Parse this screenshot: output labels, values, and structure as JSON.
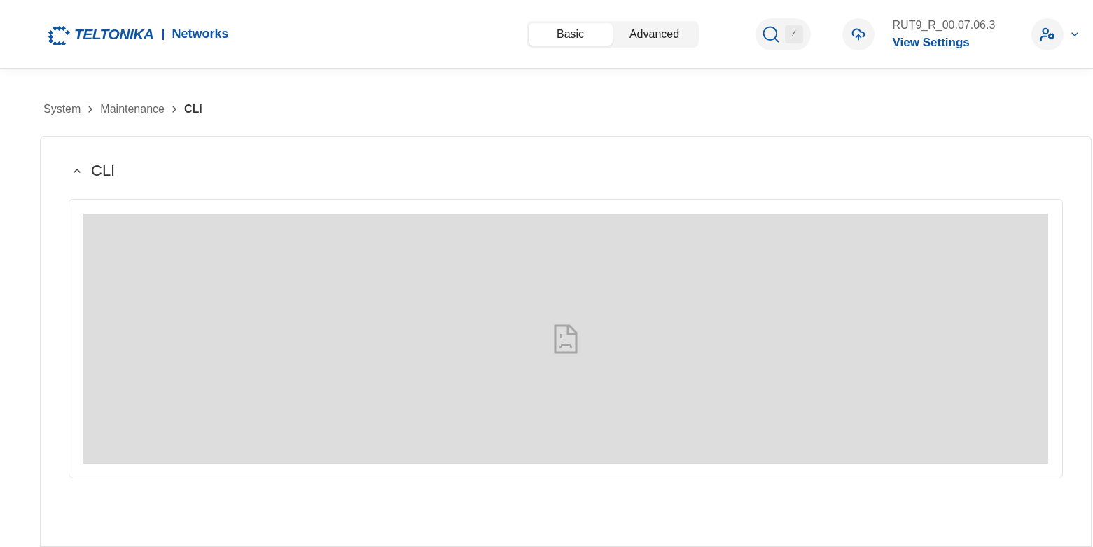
{
  "header": {
    "logo": {
      "brand": "TELTONIKA",
      "product": "Networks"
    },
    "mode_tabs": [
      {
        "label": "Basic",
        "selected": true
      },
      {
        "label": "Advanced",
        "selected": false
      }
    ],
    "search": {
      "shortcut": "/"
    },
    "firmware": {
      "version": "RUT9_R_00.07.06.3",
      "link": "View Settings"
    }
  },
  "breadcrumb": [
    {
      "label": "System",
      "current": false
    },
    {
      "label": "Maintenance",
      "current": false
    },
    {
      "label": "CLI",
      "current": true
    }
  ],
  "section": {
    "title": "CLI",
    "expanded": true
  }
}
